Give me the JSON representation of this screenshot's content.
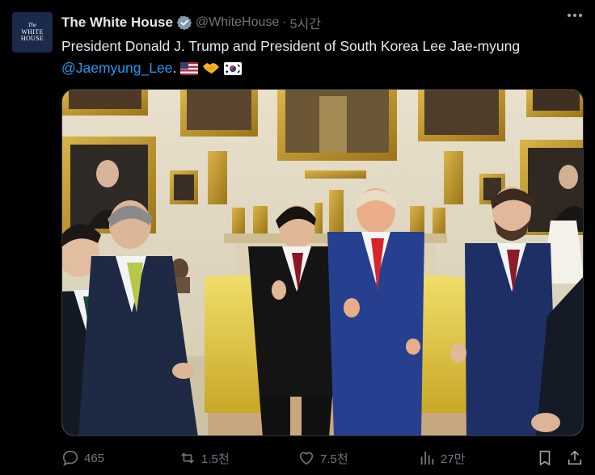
{
  "account": {
    "name": "The White House",
    "handle": "@WhiteHouse",
    "separator": "·",
    "time": "5시간",
    "avatar_text": [
      "The",
      "WHITE",
      "HOUSE"
    ]
  },
  "tweet": {
    "text_line1": "President Donald J. Trump and President of South Korea Lee Jae-myung",
    "mention": "@Jaemyung_Lee",
    "trailing": ".",
    "emojis": [
      "us-flag-emoji",
      "handshake-emoji",
      "south-korea-flag-emoji"
    ]
  },
  "stats": {
    "replies": "465",
    "reposts": "1.5천",
    "likes": "7.5천",
    "views": "27만"
  },
  "colors": {
    "background": "#000000",
    "text": "#e7e9ea",
    "muted": "#71767b",
    "accent": "#1d9bf0"
  }
}
